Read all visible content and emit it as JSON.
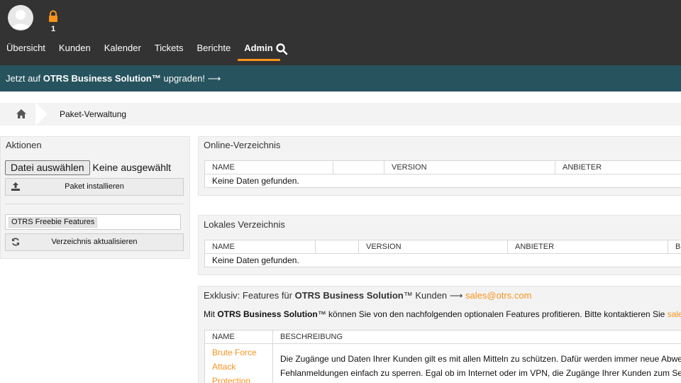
{
  "header": {
    "lock_count": "1",
    "nav": [
      "Übersicht",
      "Kunden",
      "Kalender",
      "Tickets",
      "Berichte",
      "Admin"
    ],
    "active_nav": "Admin",
    "search_icon": "search-icon"
  },
  "banner": {
    "prefix": "Jetzt auf ",
    "product": "OTRS Business Solution™",
    "suffix": " upgraden! ⟶"
  },
  "breadcrumb": {
    "home_icon": "home-icon",
    "current": "Paket-Verwaltung"
  },
  "sidebar": {
    "title": "Aktionen",
    "file_button": "Datei auswählen",
    "file_status": "Keine ausgewählt",
    "install_button": "Paket installieren",
    "repository_selected": "OTRS Freebie Features",
    "refresh_button": "Verzeichnis aktualisieren"
  },
  "online": {
    "title": "Online-Verzeichnis",
    "columns": [
      "NAME",
      "",
      "VERSION",
      "ANBIETER"
    ],
    "empty": "Keine Daten gefunden."
  },
  "local": {
    "title": "Lokales Verzeichnis",
    "columns": [
      "NAME",
      "",
      "VERSION",
      "ANBIETER",
      "B"
    ],
    "empty": "Keine Daten gefunden."
  },
  "exclusive": {
    "title_prefix": "Exklusiv: Features für ",
    "title_product": "OTRS Business Solution",
    "title_suffix": "™ Kunden ⟶ ",
    "title_email": "sales@otrs.com",
    "intro_prefix": "Mit ",
    "intro_product": "OTRS Business Solution",
    "intro_suffix": "™ können Sie von den nachfolgenden optionalen Features profitieren. Bitte kontaktieren Sie ",
    "intro_email_partial": "sale",
    "columns": [
      "NAME",
      "BESCHREIBUNG"
    ],
    "feature_name": "Brute Force Attack Protection",
    "feature_desc_line1": "Die Zugänge und Daten Ihrer Kunden gilt es mit allen Mitteln zu schützen. Dafür werden immer neue Abwe",
    "feature_desc_line2": "Fehlanmeldungen einfach zu sperren. Egal ob im Internet oder im VPN, die Zugänge Ihrer Kunden zum Se"
  },
  "colors": {
    "header_bg": "#333333",
    "banner_bg": "#26535e",
    "accent": "#f7941d"
  }
}
